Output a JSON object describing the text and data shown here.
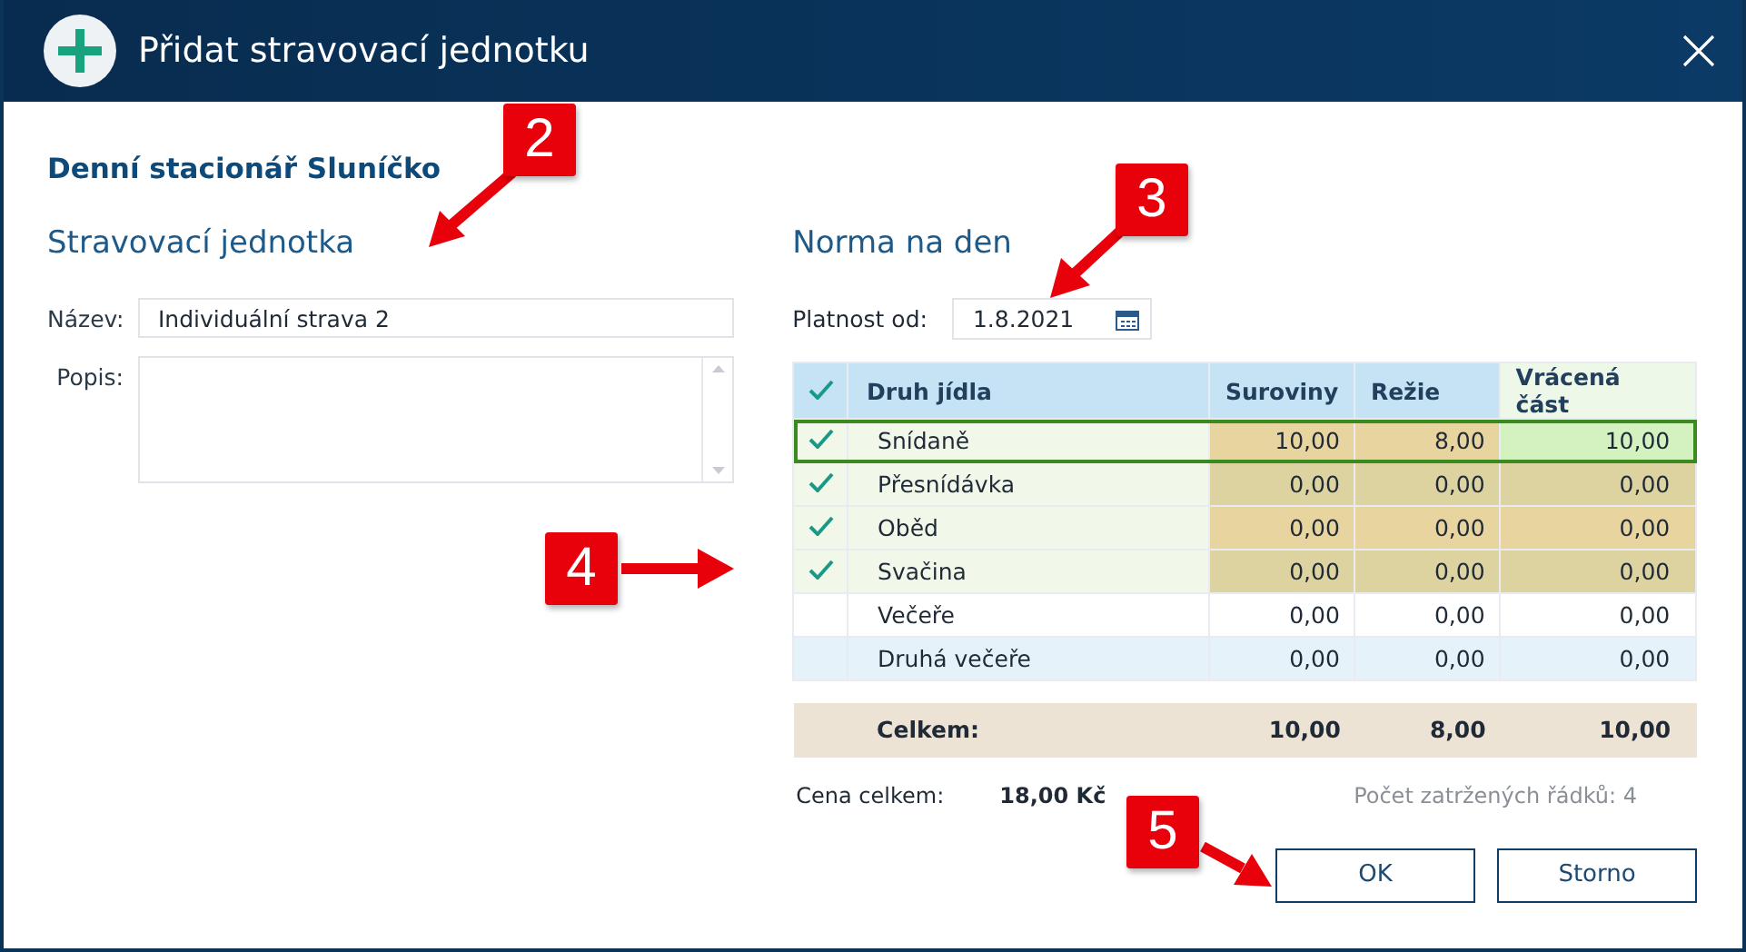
{
  "window": {
    "title": "Přidat stravovací jednotku"
  },
  "facility": "Denní stacionář Sluníčko",
  "unit": {
    "heading": "Stravovací jednotka",
    "name_label": "Název:",
    "name_value": "Individuální strava 2",
    "desc_label": "Popis:"
  },
  "norm": {
    "heading": "Norma na den",
    "valid_label": "Platnost od:",
    "valid_value": "1.8.2021"
  },
  "table": {
    "columns": [
      "Druh jídla",
      "Suroviny",
      "Režie",
      "Vrácená část"
    ],
    "rows": [
      {
        "name": "Snídaně",
        "values": [
          "10,00",
          "8,00",
          "10,00"
        ],
        "checked": true,
        "selected": true,
        "hovered": false
      },
      {
        "name": "Přesnídávka",
        "values": [
          "0,00",
          "0,00",
          "0,00"
        ],
        "checked": true,
        "selected": false,
        "hovered": false
      },
      {
        "name": "Oběd",
        "values": [
          "0,00",
          "0,00",
          "0,00"
        ],
        "checked": true,
        "selected": false,
        "hovered": false
      },
      {
        "name": "Svačina",
        "values": [
          "0,00",
          "0,00",
          "0,00"
        ],
        "checked": true,
        "selected": false,
        "hovered": false
      },
      {
        "name": "Večeře",
        "values": [
          "0,00",
          "0,00",
          "0,00"
        ],
        "checked": false,
        "selected": false,
        "hovered": false
      },
      {
        "name": "Druhá večeře",
        "values": [
          "0,00",
          "0,00",
          "0,00"
        ],
        "checked": false,
        "selected": false,
        "hovered": true
      }
    ],
    "total": {
      "label": "Celkem:",
      "values": [
        "10,00",
        "8,00",
        "10,00"
      ]
    }
  },
  "summary": {
    "price_label": "Cena celkem:",
    "price_value": "18,00 Kč",
    "count_text": "Počet zatržených řádků: 4"
  },
  "buttons": [
    "OK",
    "Storno"
  ],
  "callouts": [
    "2",
    "3",
    "4",
    "5"
  ]
}
